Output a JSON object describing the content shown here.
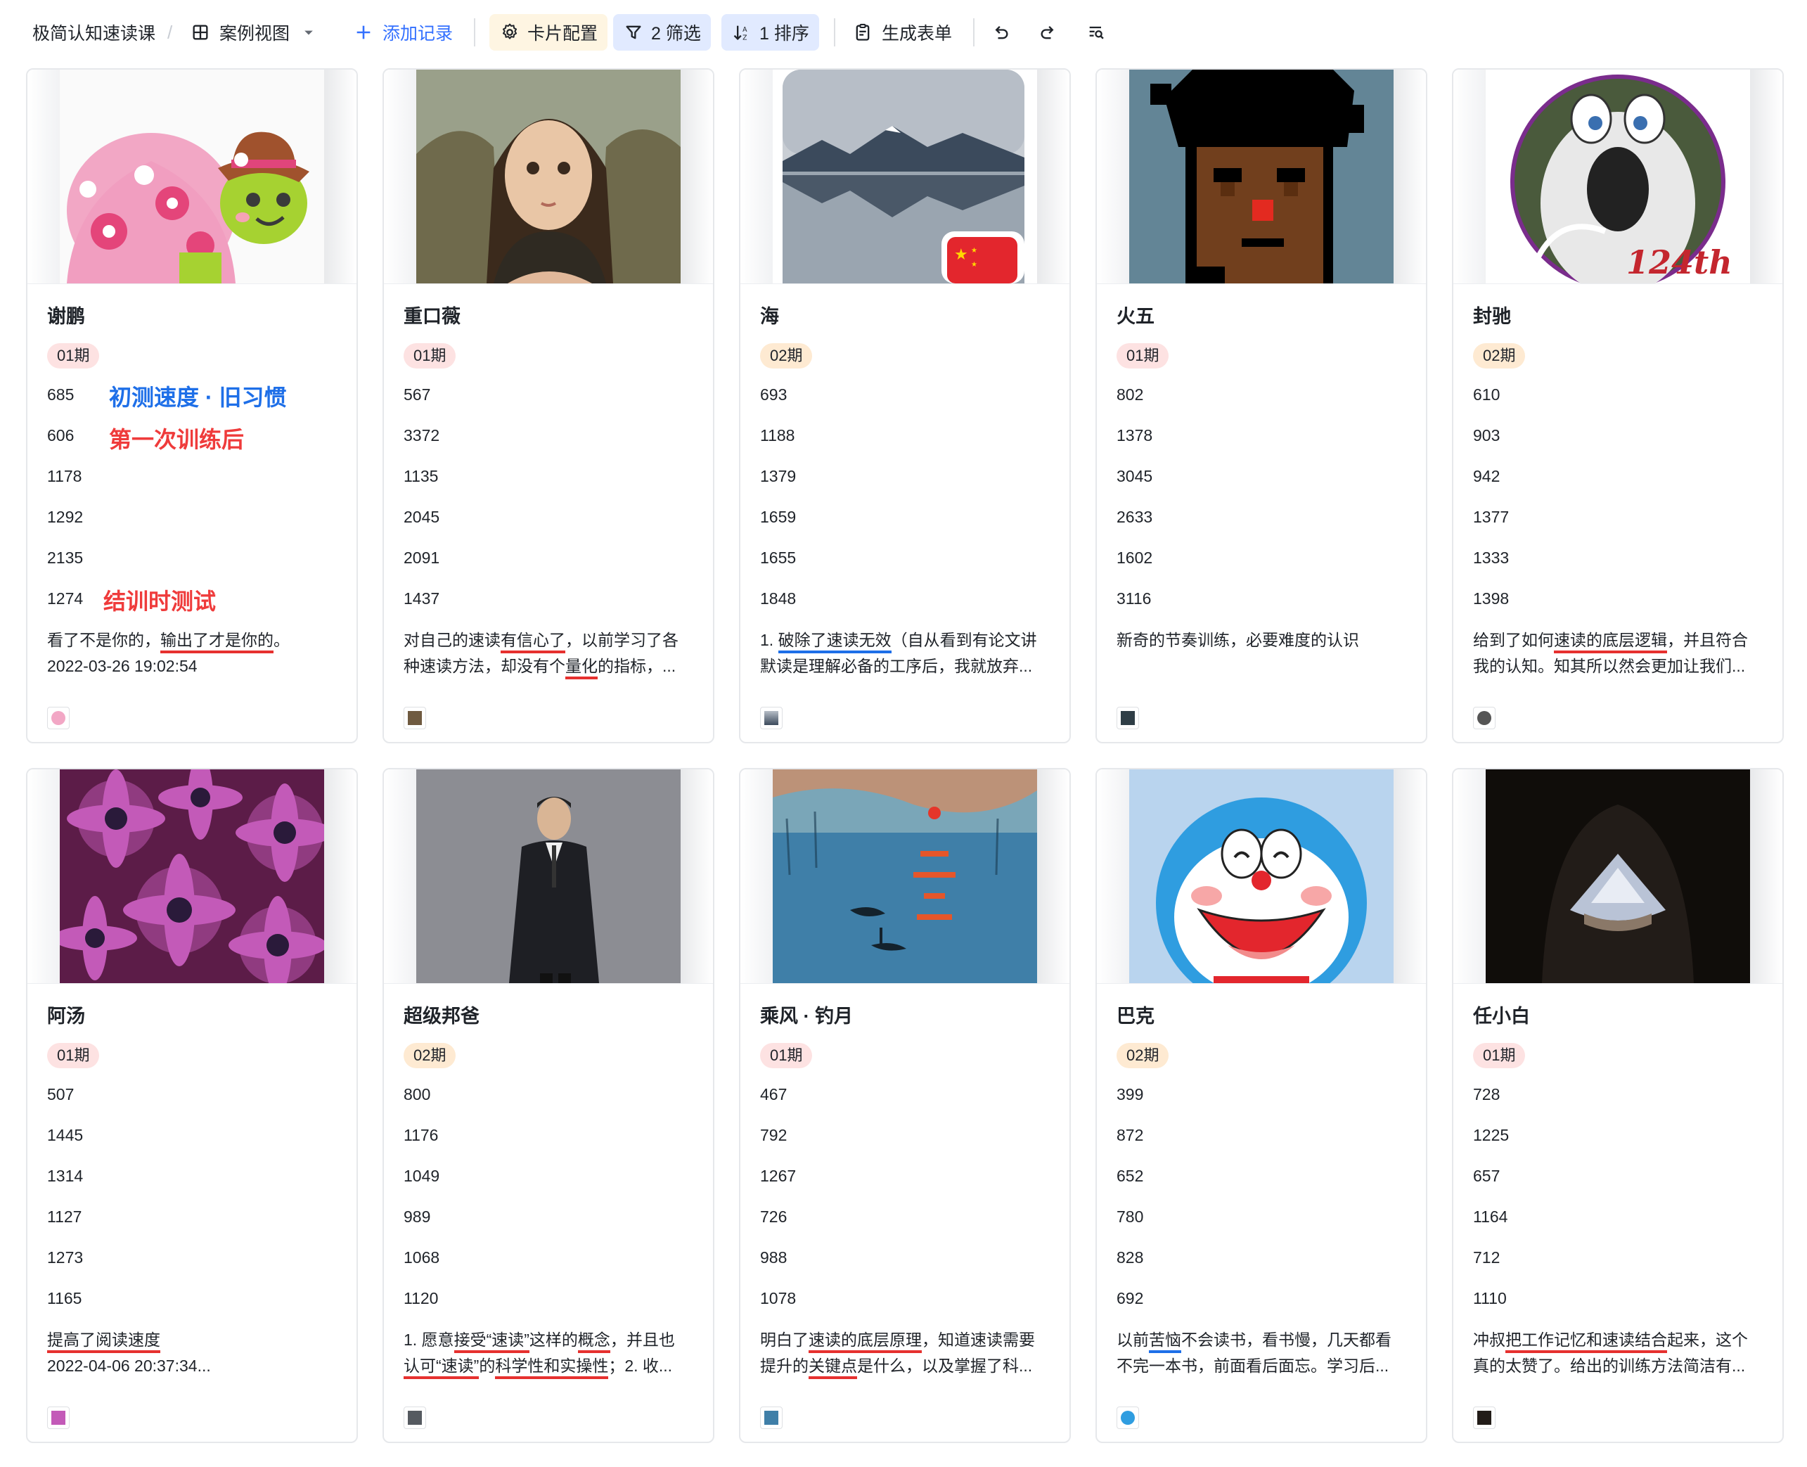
{
  "toolbar": {
    "title": "极简认知速读课",
    "view_label": "案例视图",
    "add_label": "添加记录",
    "card_config_label": "卡片配置",
    "filter_label": "2 筛选",
    "sort_label": "1 排序",
    "form_label": "生成表单"
  },
  "cards": [
    {
      "name": "谢鹏",
      "period": "01期",
      "nums": [
        "685",
        "606",
        "1178",
        "1292",
        "2135",
        "1274"
      ],
      "notes": {
        "n0": "初测速度 · 旧习惯",
        "n1": "第一次训练后",
        "n5": "结训时测试"
      },
      "desc": {
        "l1a": "看了不是你的，",
        "l1b": "输出了才是你的",
        "l1c": "。",
        "l2": "2022-03-26 19:02:54"
      }
    },
    {
      "name": "重口薇",
      "period": "01期",
      "nums": [
        "567",
        "3372",
        "1135",
        "2045",
        "2091",
        "1437"
      ],
      "desc": {
        "l1a": "对自己的速读",
        "l1b": "有信心了",
        "l1c": "，以前学习了各",
        "l2a": "种速读方法，却没有个",
        "l2b": "量化",
        "l2c": "的指标，..."
      }
    },
    {
      "name": "海",
      "period": "02期",
      "nums": [
        "693",
        "1188",
        "1379",
        "1659",
        "1655",
        "1848"
      ],
      "desc": {
        "l1a": "1. ",
        "l1b": "破除了速读无效",
        "l1c": "（自从看到有论文讲",
        "l2": "默读是理解必备的工序后，我就放弃..."
      }
    },
    {
      "name": "火五",
      "period": "01期",
      "nums": [
        "802",
        "1378",
        "3045",
        "2633",
        "1602",
        "3116"
      ],
      "desc": {
        "l1": "新奇的节奏训练，必要难度的认识"
      }
    },
    {
      "name": "封驰",
      "period": "02期",
      "nums": [
        "610",
        "903",
        "942",
        "1377",
        "1333",
        "1398"
      ],
      "art_text": "124th",
      "desc": {
        "l1a": "给到了如何",
        "l1b": "速读的底层逻辑",
        "l1c": "，并且符合",
        "l2": "我的认知。知其所以然会更加让我们..."
      }
    },
    {
      "name": "阿汤",
      "period": "01期",
      "nums": [
        "507",
        "1445",
        "1314",
        "1127",
        "1273",
        "1165"
      ],
      "desc": {
        "l1b": "提高了阅读速度",
        "l2": "2022-04-06 20:37:34..."
      }
    },
    {
      "name": "超级邦爸",
      "period": "02期",
      "nums": [
        "800",
        "1176",
        "1049",
        "989",
        "1068",
        "1120"
      ],
      "desc": {
        "l1a": "1. 愿意",
        "l1b": "接受“速读”",
        "l1c": "这样的",
        "l1d": "概念",
        "l1e": "，并且也",
        "l2b": "认可“速读”",
        "l2c": "的",
        "l2d": "科学性和实操性",
        "l2e": "；2. 收..."
      }
    },
    {
      "name": "乘风 · 钓月",
      "period": "01期",
      "nums": [
        "467",
        "792",
        "1267",
        "726",
        "988",
        "1078"
      ],
      "desc": {
        "l1a": "明白了",
        "l1b": "速读的底层原理",
        "l1c": "，知道速读需要",
        "l2a": "提升的",
        "l2b": "关键点",
        "l2c": "是什么，以及掌握了科..."
      }
    },
    {
      "name": "巴克",
      "period": "02期",
      "nums": [
        "399",
        "872",
        "652",
        "780",
        "828",
        "692"
      ],
      "desc": {
        "l1a": "以前",
        "l1b": "苦恼",
        "l1c": "不会读书，看书慢，几天都看",
        "l2": "不完一本书，前面看后面忘。学习后..."
      }
    },
    {
      "name": "任小白",
      "period": "01期",
      "nums": [
        "728",
        "1225",
        "657",
        "1164",
        "712",
        "1110"
      ],
      "desc": {
        "l1a": "冲叔",
        "l1b": "把工作记忆和速读结合",
        "l1c": "起来，这个",
        "l2": "真的太赞了。给出的训练方法简洁有..."
      }
    }
  ]
}
